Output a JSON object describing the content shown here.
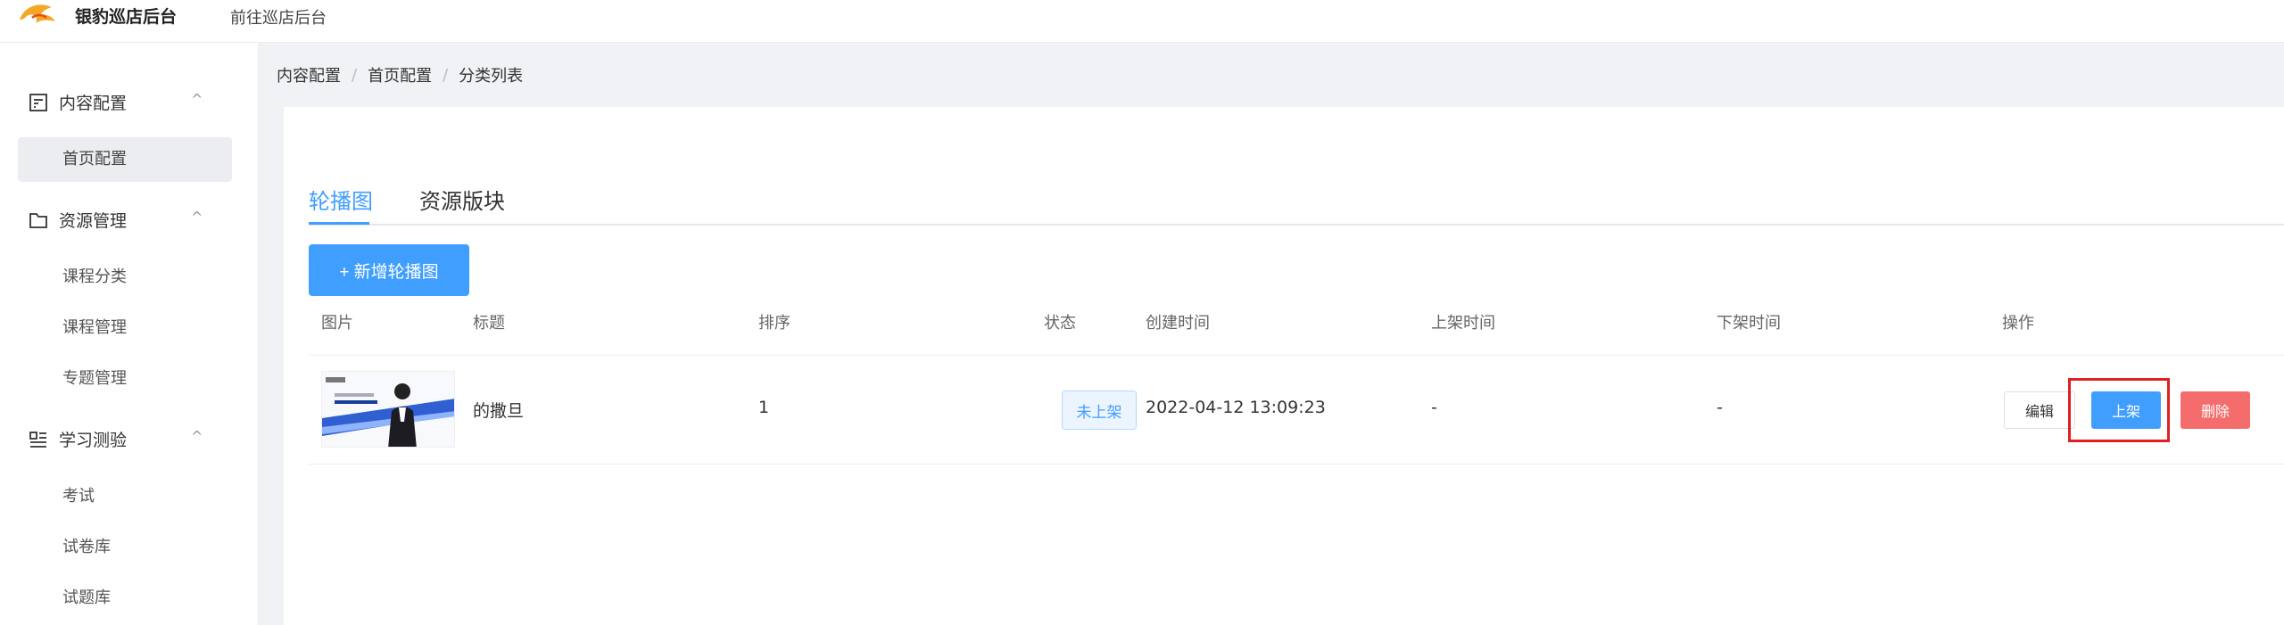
{
  "header": {
    "brand": "银豹巡店后台",
    "goto_link": "前往巡店后台"
  },
  "sidebar": {
    "groups": [
      {
        "label": "内容配置",
        "icon": "document-icon",
        "items": [
          "首页配置"
        ]
      },
      {
        "label": "资源管理",
        "icon": "folder-icon",
        "items": [
          "课程分类",
          "课程管理",
          "专题管理"
        ]
      },
      {
        "label": "学习测验",
        "icon": "list-icon",
        "items": [
          "考试",
          "试卷库",
          "试题库"
        ]
      }
    ],
    "active_item": "首页配置"
  },
  "breadcrumb": [
    "内容配置",
    "首页配置",
    "分类列表"
  ],
  "tabs": [
    "轮播图",
    "资源版块"
  ],
  "active_tab": "轮播图",
  "add_button": "+ 新增轮播图",
  "table": {
    "headers": [
      "图片",
      "标题",
      "排序",
      "状态",
      "创建时间",
      "上架时间",
      "下架时间",
      "操作"
    ],
    "rows": [
      {
        "title": "的撒旦",
        "sort": "1",
        "status": "未上架",
        "created": "2022-04-12 13:09:23",
        "on_shelf": "-",
        "off_shelf": "-",
        "actions": {
          "edit": "编辑",
          "shelf": "上架",
          "delete": "删除"
        }
      }
    ]
  },
  "colors": {
    "primary": "#409eff",
    "danger": "#f56c6c",
    "highlight": "#e02020"
  }
}
